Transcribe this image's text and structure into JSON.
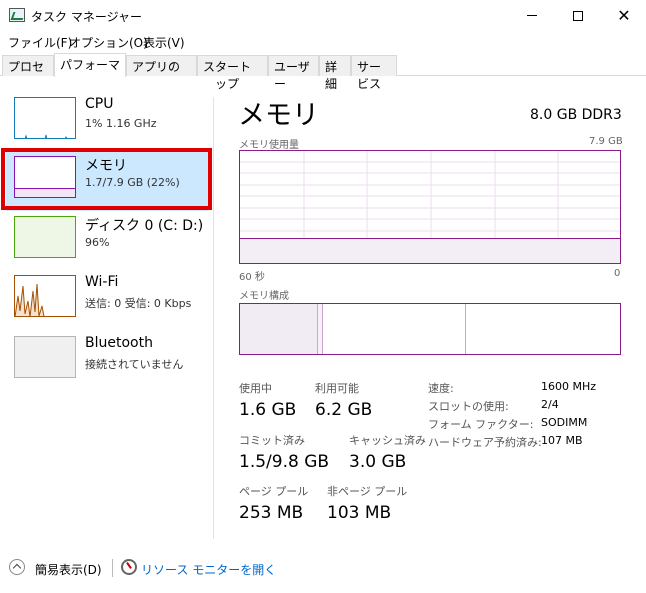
{
  "window": {
    "title": "タスク マネージャー",
    "close_glyph": "✕"
  },
  "menu": {
    "items": [
      "ファイル(F)",
      "オプション(O)",
      "表示(V)"
    ]
  },
  "tabs": [
    {
      "label": "プロセス",
      "active": false
    },
    {
      "label": "パフォーマンス",
      "active": true
    },
    {
      "label": "アプリの履歴",
      "active": false
    },
    {
      "label": "スタートアップ",
      "active": false
    },
    {
      "label": "ユーザー",
      "active": false
    },
    {
      "label": "詳細",
      "active": false
    },
    {
      "label": "サービス",
      "active": false
    }
  ],
  "resources": [
    {
      "title": "CPU",
      "sub": "1%  1.16 GHz",
      "color": "#117dbb",
      "selected": false
    },
    {
      "title": "メモリ",
      "sub": "1.7/7.9 GB (22%)",
      "color": "#8b12ae",
      "selected": true
    },
    {
      "title": "ディスク 0 (C: D:)",
      "sub": "96%",
      "color": "#4da60c",
      "selected": false
    },
    {
      "title": "Wi-Fi",
      "sub": "送信: 0  受信: 0 Kbps",
      "color": "#a74f01",
      "selected": false
    },
    {
      "title": "Bluetooth",
      "sub": "接続されていません",
      "color": "#888888",
      "selected": false
    }
  ],
  "main": {
    "title": "メモリ",
    "spec": "8.0 GB DDR3",
    "usage_graph_label": "メモリ使用量",
    "usage_graph_max": "7.9 GB",
    "time_left": "60 秒",
    "time_right": "0",
    "composition_label": "メモリ構成",
    "usage_fraction": 0.22,
    "accent_color": "#8b1a8b"
  },
  "stats": {
    "in_use_label": "使用中",
    "in_use_value": "1.6 GB",
    "available_label": "利用可能",
    "available_value": "6.2 GB",
    "committed_label": "コミット済み",
    "committed_value": "1.5/9.8 GB",
    "cached_label": "キャッシュ済み",
    "cached_value": "3.0 GB",
    "paged_label": "ページ プール",
    "paged_value": "253 MB",
    "nonpaged_label": "非ページ プール",
    "nonpaged_value": "103 MB"
  },
  "info": [
    {
      "label": "速度:",
      "value": "1600 MHz"
    },
    {
      "label": "スロットの使用:",
      "value": "2/4"
    },
    {
      "label": "フォーム ファクター:",
      "value": "SODIMM"
    },
    {
      "label": "ハードウェア予約済み:",
      "value": "107 MB"
    }
  ],
  "footer": {
    "fewer_details": "簡易表示(D)",
    "resource_monitor": "リソース モニターを開く"
  }
}
